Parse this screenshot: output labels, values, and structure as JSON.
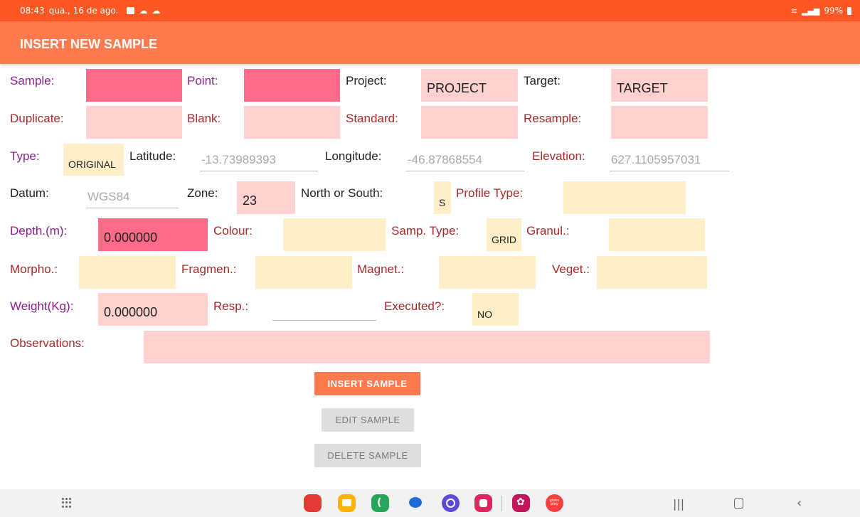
{
  "status_bar": {
    "time": "08:43",
    "date": "qua., 16 de ago.",
    "battery": "99%"
  },
  "app_bar": {
    "title": "INSERT NEW SAMPLE"
  },
  "form": {
    "sample": {
      "label": "Sample:",
      "value": ""
    },
    "point": {
      "label": "Point:",
      "value": ""
    },
    "project": {
      "label": "Project:",
      "value": "PROJECT"
    },
    "target": {
      "label": "Target:",
      "value": "TARGET"
    },
    "duplicate": {
      "label": "Duplicate:",
      "value": ""
    },
    "blank": {
      "label": "Blank:",
      "value": ""
    },
    "standard": {
      "label": "Standard:",
      "value": ""
    },
    "resample": {
      "label": "Resample:",
      "value": ""
    },
    "type": {
      "label": "Type:",
      "value": "ORIGINAL"
    },
    "latitude": {
      "label": "Latitude:",
      "placeholder": "-13.73989393"
    },
    "longitude": {
      "label": "Longitude:",
      "placeholder": "-46.87868554"
    },
    "elevation": {
      "label": "Elevation:",
      "placeholder": "627.1105957031"
    },
    "datum": {
      "label": "Datum:",
      "placeholder": "WGS84"
    },
    "zone": {
      "label": "Zone:",
      "value": "23"
    },
    "north_south": {
      "label": "North or South:",
      "value": "S"
    },
    "profile_type": {
      "label": "Profile Type:",
      "value": ""
    },
    "depth": {
      "label": "Depth.(m):",
      "value": "0.000000"
    },
    "colour": {
      "label": "Colour:",
      "value": ""
    },
    "samp_type": {
      "label": "Samp. Type:",
      "value": "GRID"
    },
    "granul": {
      "label": "Granul.:",
      "value": ""
    },
    "morpho": {
      "label": "Morpho.:",
      "value": ""
    },
    "fragmen": {
      "label": "Fragmen.:",
      "value": ""
    },
    "magnet": {
      "label": "Magnet.:",
      "value": ""
    },
    "veget": {
      "label": "Veget.:",
      "value": ""
    },
    "weight": {
      "label": "Weight(Kg):",
      "value": "0.000000"
    },
    "resp": {
      "label": "Resp.:",
      "value": ""
    },
    "executed": {
      "label": "Executed?:",
      "value": "NO"
    },
    "observations": {
      "label": "Observations:",
      "value": ""
    }
  },
  "buttons": {
    "insert": "INSERT SAMPLE",
    "edit": "EDIT SAMPLE",
    "delete": "DELETE SAMPLE"
  },
  "nav": {
    "apps_grid_icon": "apps-grid-icon",
    "recents": "|||",
    "home": "home-icon",
    "back": "back-icon",
    "dock_apps": [
      "red-app-icon",
      "files-app-icon",
      "phone-app-icon",
      "messages-app-icon",
      "internet-app-icon",
      "camera-app-icon",
      "flower-app-icon",
      "globoplay-app-icon"
    ],
    "globoplay_text": "globo play"
  },
  "colors": {
    "status_bar": "#ff5722",
    "app_bar": "#ff7a4f",
    "required_field": "#ff6b88",
    "text_field": "#ffd1d1",
    "spinner_field": "#ffeec8"
  }
}
